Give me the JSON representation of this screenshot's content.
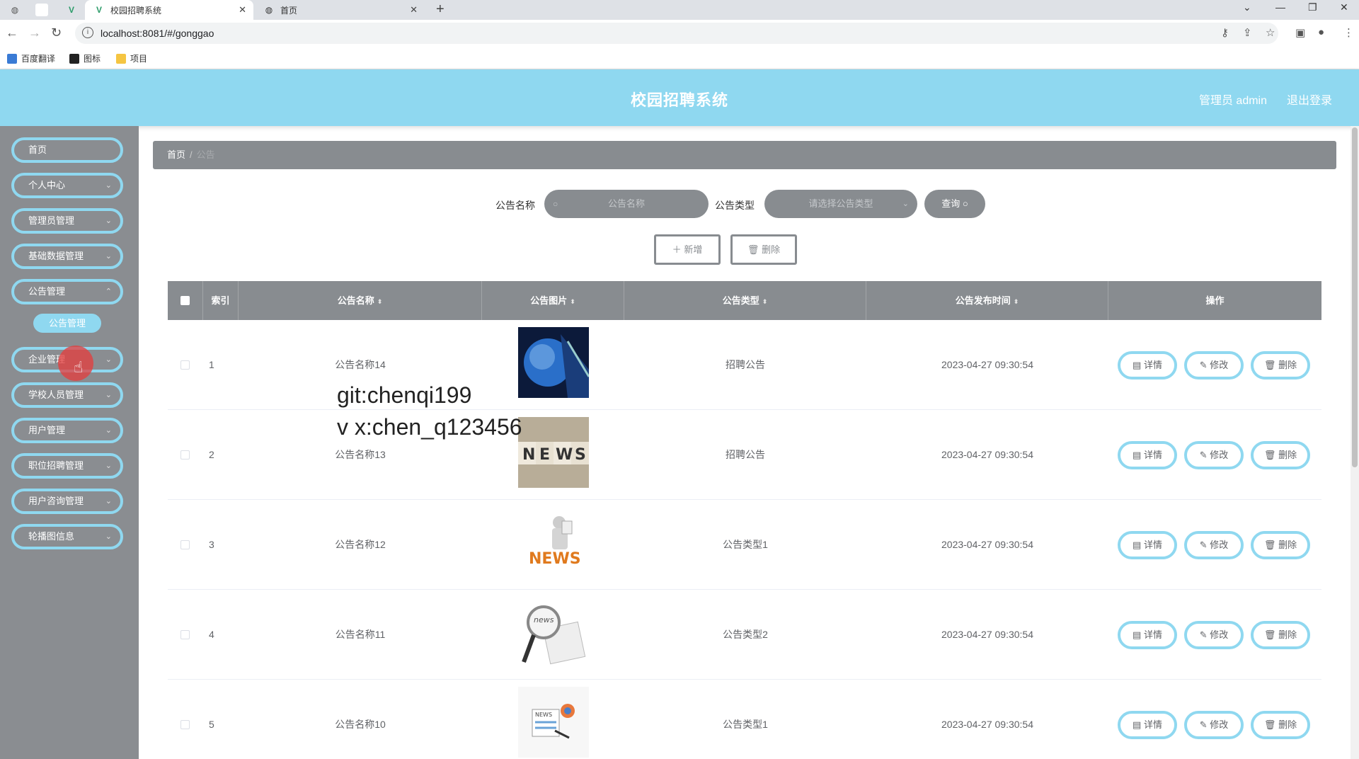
{
  "browser": {
    "tabs": [
      {
        "label": "校园招聘系统",
        "active": true
      },
      {
        "label": "首页",
        "active": false
      }
    ],
    "url": "localhost:8081/#/gonggao",
    "bookmarks": [
      "百度翻译",
      "图标",
      "项目"
    ]
  },
  "header": {
    "title": "校园招聘系统",
    "user": "管理员 admin",
    "logout": "退出登录"
  },
  "sidebar": {
    "items": [
      {
        "label": "首页",
        "has_chevron": false
      },
      {
        "label": "个人中心",
        "has_chevron": true
      },
      {
        "label": "管理员管理",
        "has_chevron": true
      },
      {
        "label": "基础数据管理",
        "has_chevron": true
      },
      {
        "label": "公告管理",
        "has_chevron": true
      },
      {
        "label": "企业管理",
        "has_chevron": true
      },
      {
        "label": "学校人员管理",
        "has_chevron": true
      },
      {
        "label": "用户管理",
        "has_chevron": true
      },
      {
        "label": "职位招聘管理",
        "has_chevron": true
      },
      {
        "label": "用户咨询管理",
        "has_chevron": true
      },
      {
        "label": "轮播图信息",
        "has_chevron": true
      }
    ],
    "active_sub": "公告管理"
  },
  "breadcrumb": {
    "home": "首页",
    "current": "公告"
  },
  "search": {
    "name_label": "公告名称",
    "name_placeholder": "公告名称",
    "type_label": "公告类型",
    "type_placeholder": "请选择公告类型",
    "button": "查询"
  },
  "actions": {
    "add": "新增",
    "delete": "删除"
  },
  "table": {
    "headers": {
      "index": "索引",
      "name": "公告名称",
      "image": "公告图片",
      "type": "公告类型",
      "time": "公告发布时间",
      "ops": "操作"
    },
    "rows": [
      {
        "index": "1",
        "name": "公告名称14",
        "type": "招聘公告",
        "time": "2023-04-27 09:30:54",
        "image": "globe"
      },
      {
        "index": "2",
        "name": "公告名称13",
        "type": "招聘公告",
        "time": "2023-04-27 09:30:54",
        "image": "news-blocks"
      },
      {
        "index": "3",
        "name": "公告名称12",
        "type": "公告类型1",
        "time": "2023-04-27 09:30:54",
        "image": "news-figure"
      },
      {
        "index": "4",
        "name": "公告名称11",
        "type": "公告类型2",
        "time": "2023-04-27 09:30:54",
        "image": "magnifier"
      },
      {
        "index": "5",
        "name": "公告名称10",
        "type": "公告类型1",
        "time": "2023-04-27 09:30:54",
        "image": "news-paper"
      }
    ],
    "row_buttons": {
      "detail": "详情",
      "edit": "修改",
      "delete": "删除"
    }
  },
  "watermark": [
    "git:chenqi199",
    "v x:chen_q123456"
  ],
  "colors": {
    "accent": "#8fd8f0",
    "gray": "#888c90"
  }
}
